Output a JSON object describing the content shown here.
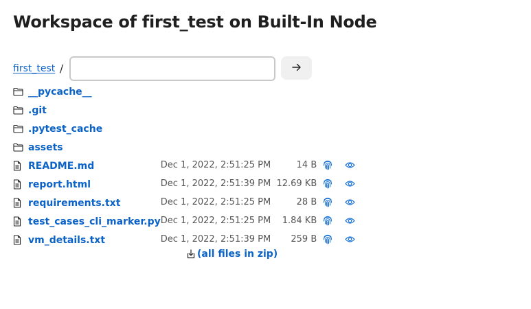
{
  "page": {
    "title": "Workspace of first_test on Built-In Node"
  },
  "breadcrumb": {
    "root": "first_test",
    "separator": "/"
  },
  "path_input": {
    "value": "",
    "placeholder": ""
  },
  "go_button": {
    "icon": "arrow-right-icon"
  },
  "colors": {
    "link": "#0b63c7",
    "muted": "#555555",
    "action_icon": "#1a73d9"
  },
  "entries": [
    {
      "type": "folder",
      "name": "__pycache__"
    },
    {
      "type": "folder",
      "name": ".git"
    },
    {
      "type": "folder",
      "name": ".pytest_cache"
    },
    {
      "type": "folder",
      "name": "assets"
    },
    {
      "type": "file",
      "name": "README.md",
      "modified": "Dec 1, 2022, 2:51:25 PM",
      "size": "14 B"
    },
    {
      "type": "file",
      "name": "report.html",
      "modified": "Dec 1, 2022, 2:51:39 PM",
      "size": "12.69 KB"
    },
    {
      "type": "file",
      "name": "requirements.txt",
      "modified": "Dec 1, 2022, 2:51:25 PM",
      "size": "28 B"
    },
    {
      "type": "file",
      "name": "test_cases_cli_marker.py",
      "modified": "Dec 1, 2022, 2:51:25 PM",
      "size": "1.84 KB"
    },
    {
      "type": "file",
      "name": "vm_details.txt",
      "modified": "Dec 1, 2022, 2:51:39 PM",
      "size": "259 B"
    }
  ],
  "zip": {
    "label": "(all files in zip)"
  }
}
